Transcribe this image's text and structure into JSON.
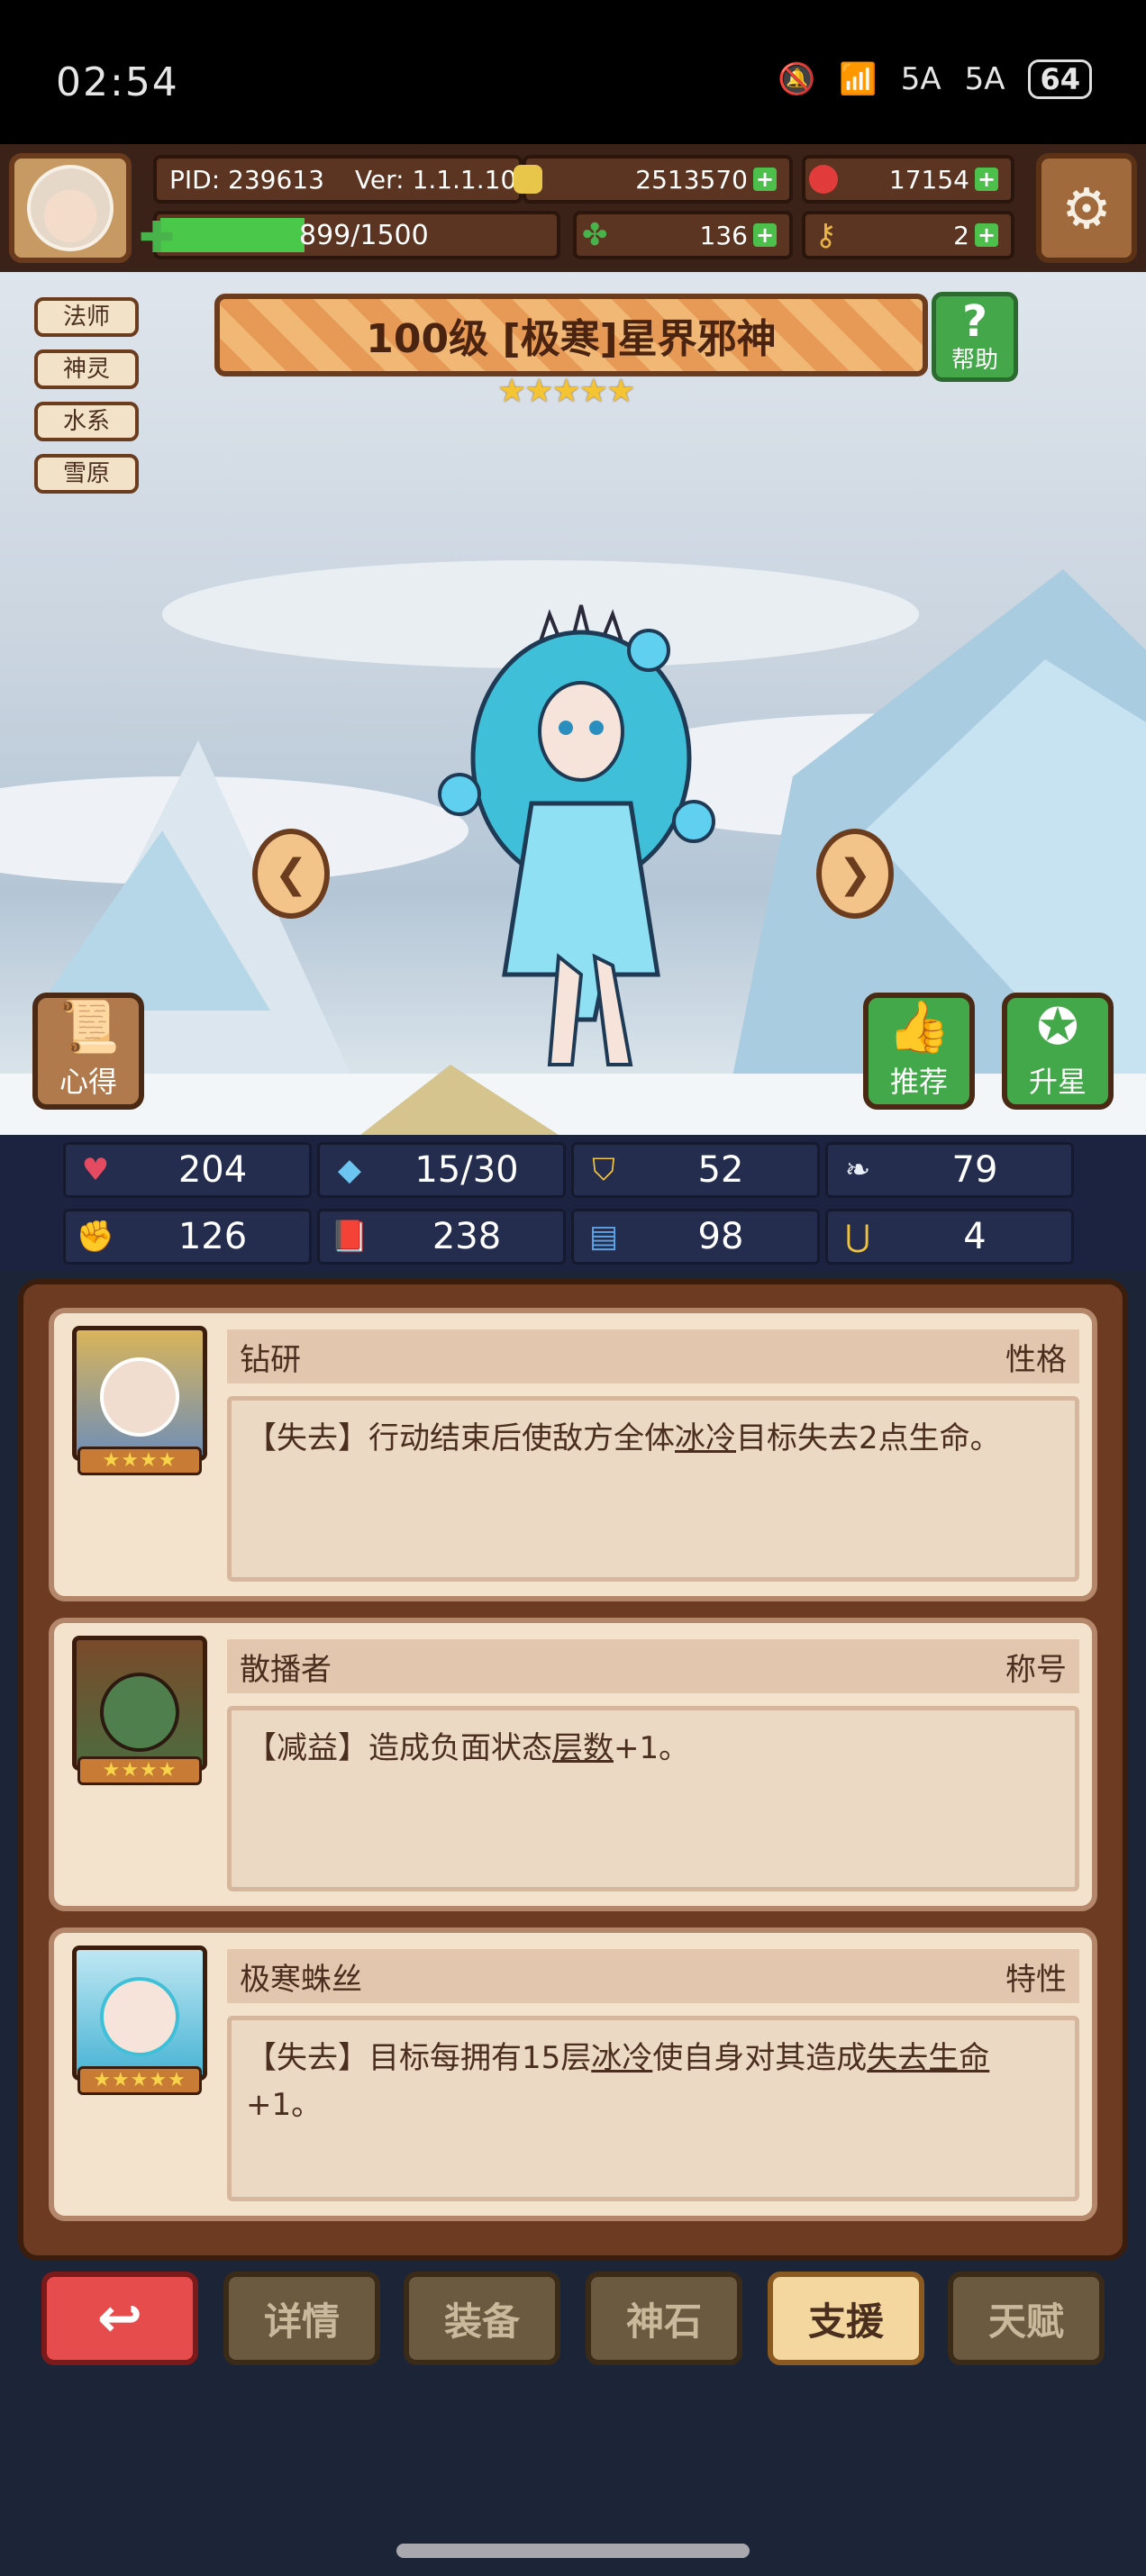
{
  "status_bar": {
    "time": "02:54",
    "signal1": "5A",
    "signal2": "5A",
    "battery": "64"
  },
  "hud": {
    "pid": "PID: 239613",
    "version": "Ver: 1.1.1.10",
    "gold": "2513570",
    "gems": "17154",
    "energy": "899/1500",
    "clover": "136",
    "key": "2",
    "colors": {
      "gold": "#e8c64a",
      "gem": "#e23b3b",
      "clover": "#49b34b",
      "key": "#e8b445"
    }
  },
  "tags": [
    "法师",
    "神灵",
    "水系",
    "雪原"
  ],
  "hero": {
    "title": "100级 [极寒]星界邪神",
    "stars": "★★★★★",
    "help_label": "帮助"
  },
  "scene_buttons": {
    "notes": "心得",
    "recommend": "推荐",
    "star_up": "升星"
  },
  "stats": [
    {
      "icon": "heart-icon",
      "value": "204",
      "color": "#e44b61"
    },
    {
      "icon": "mana-drop-icon",
      "value": "15/30",
      "color": "#6cc5f0"
    },
    {
      "icon": "shield-icon",
      "value": "52",
      "color": "#f3c33a"
    },
    {
      "icon": "wing-icon",
      "value": "79",
      "color": "#e8eef5"
    },
    {
      "icon": "fist-icon",
      "value": "126",
      "color": "#e8a078"
    },
    {
      "icon": "book-icon",
      "value": "238",
      "color": "#d6404b"
    },
    {
      "icon": "scroll-icon",
      "value": "98",
      "color": "#5ea4e4"
    },
    {
      "icon": "magnet-icon",
      "value": "4",
      "color": "#f2c23a"
    }
  ],
  "cards": [
    {
      "name": "钻研",
      "type": "性格",
      "stars": "★★★★",
      "desc_parts": [
        "【失去】行动结束后使敌方全体",
        "冰冷",
        "目标失去2点生命。"
      ]
    },
    {
      "name": "散播者",
      "type": "称号",
      "stars": "★★★★",
      "desc_parts": [
        "【减益】造成负面状态",
        "层数",
        "+1。"
      ]
    },
    {
      "name": "极寒蛛丝",
      "type": "特性",
      "stars": "★★★★★",
      "desc_parts": [
        "【失去】目标每拥有15层",
        "冰冷",
        "使自身对其造成",
        "失去生命",
        "+1。"
      ]
    }
  ],
  "nav": {
    "back": "↩",
    "details": "详情",
    "equip": "装备",
    "god_stone": "神石",
    "support": "支援",
    "talent": "天赋"
  }
}
